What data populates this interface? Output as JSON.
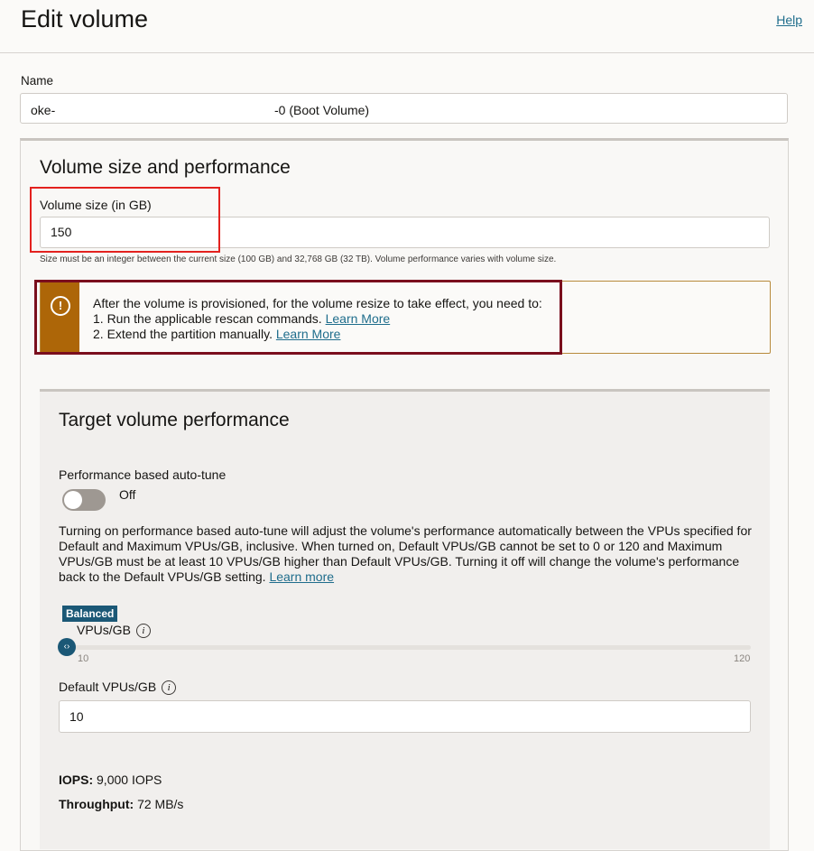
{
  "header": {
    "title": "Edit volume",
    "help": "Help"
  },
  "name": {
    "label": "Name",
    "prefix": "oke-",
    "suffix": "-0 (Boot Volume)"
  },
  "size_section": {
    "title": "Volume size and performance",
    "label": "Volume size (in GB)",
    "value": "150",
    "hint": "Size must be an integer between the current size (100 GB) and 32,768 GB (32 TB). Volume performance varies with volume size."
  },
  "warning": {
    "icon": "exclamation-icon",
    "line1": "After the volume is provisioned, for the volume resize to take effect, you need to:",
    "line2": "1. Run the applicable rescan commands.",
    "line2_link": "Learn More",
    "line3": "2. Extend the partition manually.",
    "line3_link": "Learn More"
  },
  "performance": {
    "title": "Target volume performance",
    "autotune_label": "Performance based auto-tune",
    "autotune_state": "Off",
    "description": "Turning on performance based auto-tune will adjust the volume's performance automatically between the VPUs specified for Default and Maximum VPUs/GB, inclusive. When turned on, Default VPUs/GB cannot be set to 0 or 120 and Maximum VPUs/GB must be at least 10 VPUs/GB higher than Default VPUs/GB. Turning it off will change the volume's performance back to the Default VPUs/GB setting.",
    "description_link": "Learn more",
    "badge": "Balanced",
    "slider_label": "VPUs/GB",
    "slider_min": "10",
    "slider_max": "120",
    "slider_value": 10,
    "default_label": "Default VPUs/GB",
    "default_value": "10",
    "iops_label": "IOPS:",
    "iops_value": "9,000 IOPS",
    "throughput_label": "Throughput:",
    "throughput_value": "72 MB/s"
  },
  "colors": {
    "accent": "#1b5876",
    "warning": "#ad6608",
    "link": "#1f6d8c"
  }
}
